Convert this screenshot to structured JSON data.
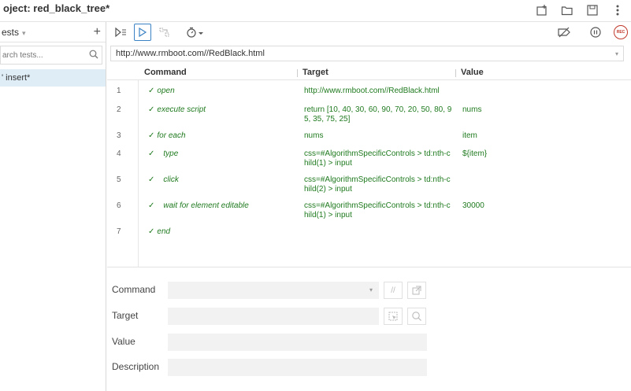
{
  "window": {
    "title_prefix": "oject:",
    "project_name": "red_black_tree*"
  },
  "sidebar": {
    "header_label": "ests",
    "add_label": "+",
    "search_placeholder": "arch tests...",
    "tests": [
      {
        "label": "' insert*"
      }
    ]
  },
  "toolbar": {
    "url": "http://www.rmboot.com//RedBlack.html",
    "rec_label": "REC"
  },
  "table": {
    "headers": {
      "command": "Command",
      "target": "Target",
      "value": "Value"
    },
    "rows": [
      {
        "num": "1",
        "command": "open",
        "target": "http://www.rmboot.com//RedBlack.html",
        "value": ""
      },
      {
        "num": "2",
        "command": "execute script",
        "target": "return [10, 40, 30, 60, 90, 70, 20, 50, 80, 95, 35, 75, 25]",
        "value": "nums"
      },
      {
        "num": "3",
        "command": "for each",
        "target": "nums",
        "value": "item"
      },
      {
        "num": "4",
        "command": "type",
        "target": "css=#AlgorithmSpecificControls > td:nth-child(1) > input",
        "value": "${item}"
      },
      {
        "num": "5",
        "command": "click",
        "target": "css=#AlgorithmSpecificControls > td:nth-child(2) > input",
        "value": ""
      },
      {
        "num": "6",
        "command": "wait for element editable",
        "target": "css=#AlgorithmSpecificControls > td:nth-child(1) > input",
        "value": "30000"
      },
      {
        "num": "7",
        "command": "end",
        "target": "",
        "value": ""
      }
    ]
  },
  "editor": {
    "command_label": "Command",
    "target_label": "Target",
    "value_label": "Value",
    "description_label": "Description",
    "comment_btn": "//"
  },
  "icons": {
    "check": "✓"
  }
}
